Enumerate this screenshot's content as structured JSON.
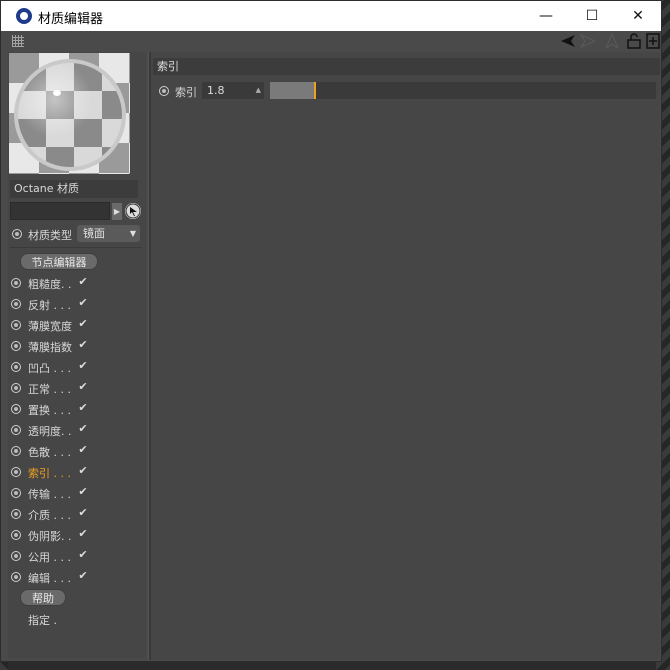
{
  "window": {
    "title": "材质编辑器",
    "minimize_glyph": "—",
    "maximize_glyph": "☐",
    "close_glyph": "✕"
  },
  "toolbar": {
    "icons": [
      "grid-grip-icon",
      "arrow-left-icon",
      "arrow-right-icon",
      "lock-icon",
      "new-window-icon"
    ]
  },
  "material": {
    "name": "Octane 材质",
    "type_label": "材质类型",
    "type_value": "镜面"
  },
  "buttons": {
    "node_editor": "节点编辑器",
    "help": "帮助"
  },
  "channels": [
    {
      "label": "粗糙度. .",
      "checked": true,
      "active": false
    },
    {
      "label": "反射 . . .",
      "checked": true,
      "active": false
    },
    {
      "label": "薄膜宽度",
      "checked": true,
      "active": false
    },
    {
      "label": "薄膜指数",
      "checked": true,
      "active": false
    },
    {
      "label": "凹凸 . . .",
      "checked": true,
      "active": false
    },
    {
      "label": "正常 . . .",
      "checked": true,
      "active": false
    },
    {
      "label": "置换 . . .",
      "checked": true,
      "active": false
    },
    {
      "label": "透明度. .",
      "checked": true,
      "active": false
    },
    {
      "label": "色散 . . .",
      "checked": true,
      "active": false
    },
    {
      "label": "索引 . . .",
      "checked": true,
      "active": true
    },
    {
      "label": "传输 . . .",
      "checked": true,
      "active": false
    },
    {
      "label": "介质 . . .",
      "checked": true,
      "active": false
    },
    {
      "label": "伪阴影. .",
      "checked": true,
      "active": false
    },
    {
      "label": "公用 . . .",
      "checked": true,
      "active": false
    },
    {
      "label": "编辑 . . .",
      "checked": true,
      "active": false
    }
  ],
  "assign_label": "指定 .",
  "panel": {
    "section_title": "索引",
    "param_label": "索引",
    "param_value": "1.8",
    "slider_fraction": 0.114
  },
  "colors": {
    "accent": "#f0a020",
    "panel_bg": "#464646"
  }
}
